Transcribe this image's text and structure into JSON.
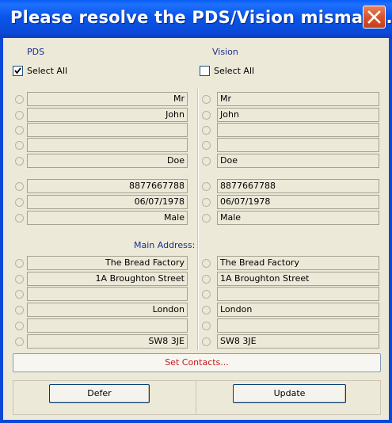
{
  "window": {
    "title": "Please resolve the PDS/Vision mismatc…"
  },
  "pds": {
    "header": "PDS",
    "select_all_label": "Select All",
    "select_all_checked": true,
    "fields": [
      "Mr",
      "John",
      "",
      "",
      "Doe",
      "8877667788",
      "06/07/1978",
      "Male",
      "The Bread Factory",
      "1A Broughton Street",
      "",
      "London",
      "",
      "SW8 3JE"
    ]
  },
  "vision": {
    "header": "Vision",
    "select_all_label": "Select All",
    "select_all_checked": false,
    "fields": [
      "Mr",
      "John",
      "",
      "",
      "Doe",
      "8877667788",
      "06/07/1978",
      "Male",
      "The Bread Factory",
      "1A Broughton Street",
      "",
      "London",
      "",
      "SW8 3JE"
    ]
  },
  "main_address_label": "Main Address:",
  "buttons": {
    "set_contacts": "Set Contacts...",
    "defer": "Defer",
    "update": "Update"
  },
  "colors": {
    "title_bar": "#0a49d6",
    "dialog_bg": "#ece9d8",
    "header_text": "#1b2d8f",
    "set_contacts_text": "#c01d1d"
  }
}
